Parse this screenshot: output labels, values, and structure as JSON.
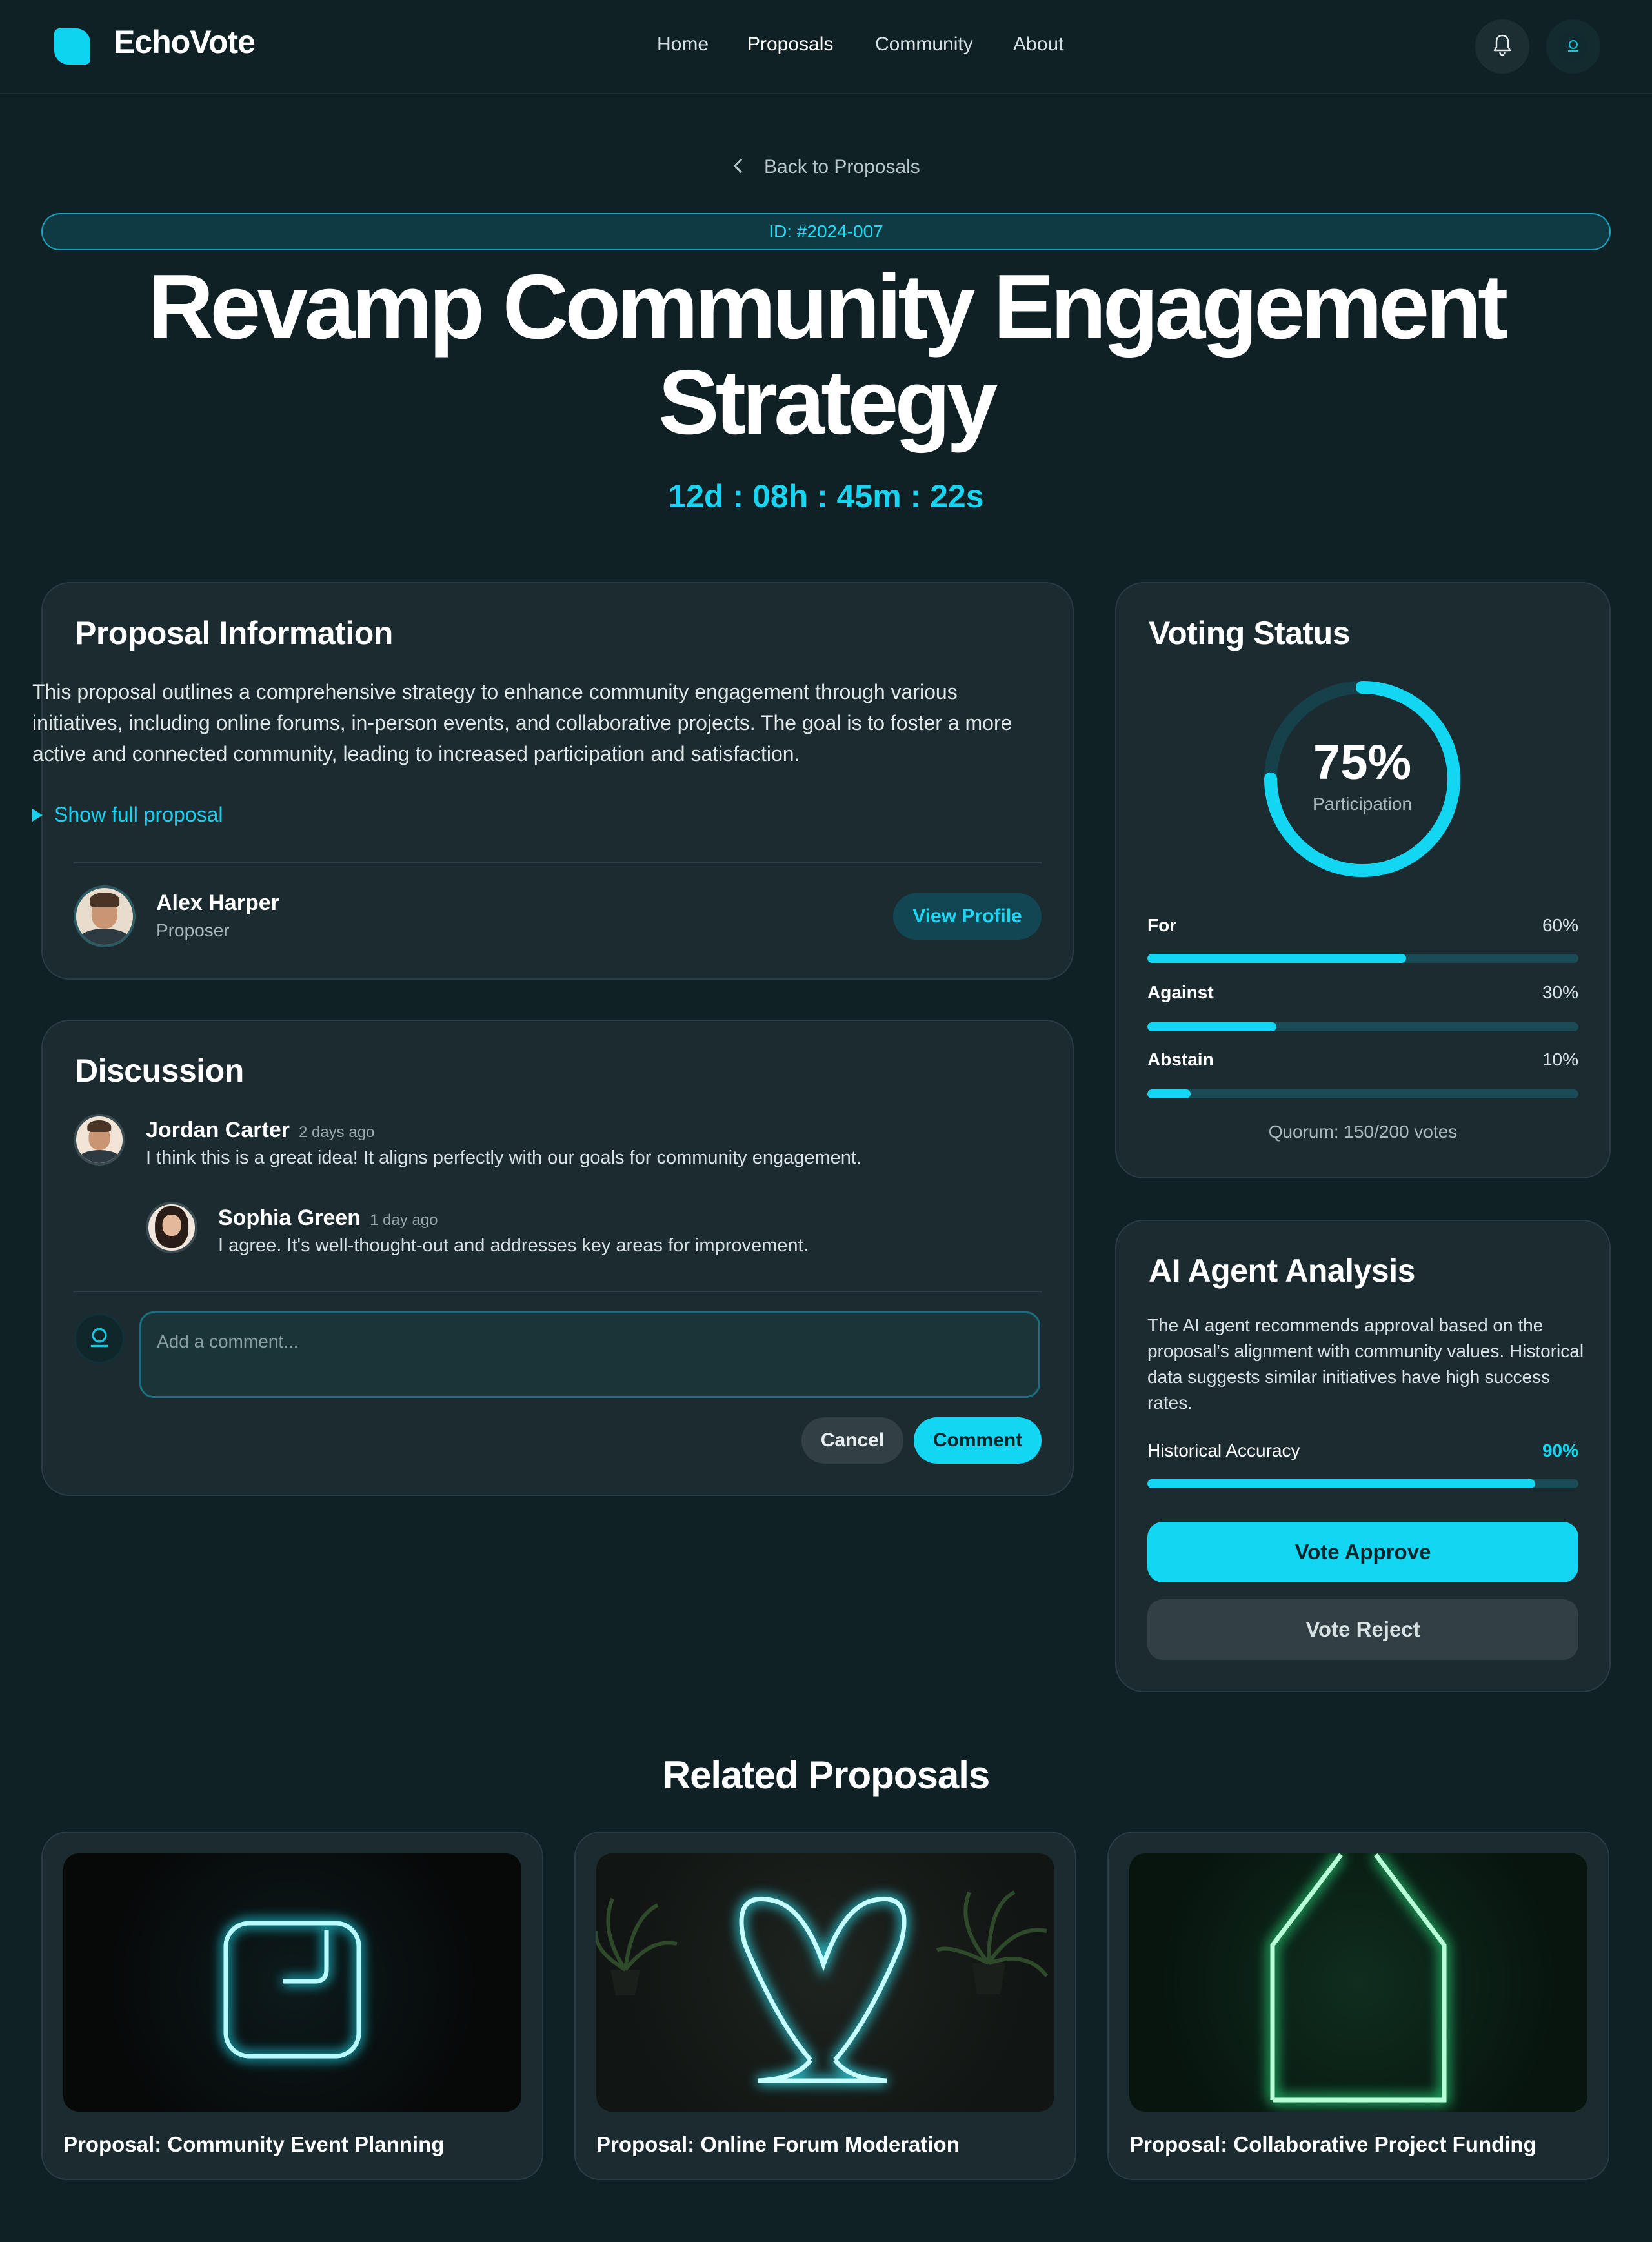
{
  "header": {
    "brand": "EchoVote",
    "nav": [
      "Home",
      "Proposals",
      "Community",
      "About"
    ],
    "active_nav": "Proposals"
  },
  "back_link": "Back to Proposals",
  "proposal": {
    "id_label": "ID: #2024-007",
    "title_line1": "Revamp Community Engagement",
    "title_line2": "Strategy",
    "countdown": "12d : 08h : 45m : 22s"
  },
  "info": {
    "heading": "Proposal Information",
    "description": "This proposal outlines a comprehensive strategy to enhance community engagement through various initiatives, including online forums, in-person events, and collaborative projects. The goal is to foster a more active and connected community, leading to increased participation and satisfaction.",
    "show_full": "Show full proposal",
    "proposer_name": "Alex Harper",
    "proposer_role": "Proposer",
    "view_profile": "View Profile"
  },
  "discussion": {
    "heading": "Discussion",
    "comments": [
      {
        "author": "Jordan Carter",
        "time": "2 days ago",
        "text": "I think this is a great idea! It aligns perfectly with our goals for community engagement."
      },
      {
        "author": "Sophia Green",
        "time": "1 day ago",
        "text": "I agree. It's well-thought-out and addresses key areas for improvement."
      }
    ],
    "input_placeholder": "Add a comment...",
    "cancel": "Cancel",
    "comment": "Comment"
  },
  "voting": {
    "heading": "Voting Status",
    "participation_pct": "75%",
    "participation_value": 0.75,
    "participation_label": "Participation",
    "bars": [
      {
        "label": "For",
        "pct": "60%",
        "value": 0.6
      },
      {
        "label": "Against",
        "pct": "30%",
        "value": 0.3
      },
      {
        "label": "Abstain",
        "pct": "10%",
        "value": 0.1
      }
    ],
    "quorum": "Quorum: 150/200 votes"
  },
  "ai": {
    "heading": "AI Agent Analysis",
    "text": "The AI agent recommends approval based on the proposal's alignment with community values. Historical data suggests similar initiatives have high success rates.",
    "accuracy_label": "Historical Accuracy",
    "accuracy_pct": "90%",
    "accuracy_value": 0.9,
    "approve": "Vote Approve",
    "reject": "Vote Reject"
  },
  "related": {
    "heading": "Related Proposals",
    "items": [
      {
        "title": "Proposal: Community Event Planning",
        "icon": "neon-square-icon"
      },
      {
        "title": "Proposal: Online Forum Moderation",
        "icon": "neon-heart-icon"
      },
      {
        "title": "Proposal: Collaborative Project Funding",
        "icon": "neon-house-icon"
      }
    ]
  },
  "colors": {
    "accent": "#12d6f2",
    "background": "#102125",
    "card": "#1b2b30"
  }
}
